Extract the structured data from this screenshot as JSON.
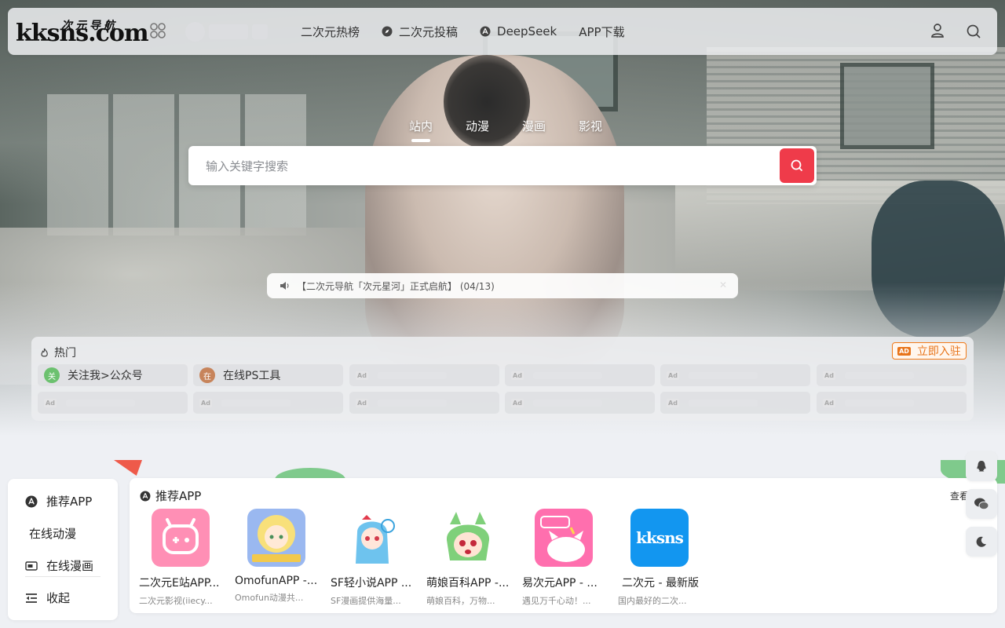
{
  "brand": {
    "logo_main": "kksns.com",
    "logo_sub": "次元导航"
  },
  "nav": {
    "links": [
      {
        "label": "二次元热榜",
        "icon": "none"
      },
      {
        "label": "二次元投稿",
        "icon": "compass-icon"
      },
      {
        "label": "DeepSeek",
        "icon": "app-store-icon"
      },
      {
        "label": "APP下载",
        "icon": "none"
      }
    ]
  },
  "search": {
    "tabs": [
      "站内",
      "动漫",
      "漫画",
      "影视"
    ],
    "active_tab": "站内",
    "placeholder": "输入关键字搜索",
    "button_color": "#ef3b4a"
  },
  "notice": {
    "text": "【二次元导航「次元星河」正式启航】 (04/13)"
  },
  "hot": {
    "title": "热门",
    "join_label": "立即入驻",
    "join_badge": "AD",
    "cells": [
      {
        "label": "关注我>公众号",
        "avatar_text": "关",
        "avatar_color": "#6cc16f"
      },
      {
        "label": "在线PS工具",
        "avatar_text": "在",
        "avatar_color": "#c7845b"
      }
    ],
    "ad_tag": "Ad"
  },
  "sidebar": {
    "items": [
      {
        "label": "推荐APP",
        "icon": "app-store-icon"
      },
      {
        "label": "在线动漫",
        "icon": "none"
      },
      {
        "label": "在线漫画",
        "icon": "comic-icon"
      },
      {
        "label": "收起",
        "icon": "collapse-icon"
      }
    ]
  },
  "panel": {
    "title": "推荐APP",
    "more": "查看更多",
    "apps": [
      {
        "name": "二次元E站APP...",
        "desc": "二次元影视(iiecy...",
        "icon_color": "#ff8fb5"
      },
      {
        "name": "OmofunAPP -...",
        "desc": "Omofun动漫共...",
        "icon_color": "#9ab8f0"
      },
      {
        "name": "SF轻小说APP ...",
        "desc": "SF漫画提供海量...",
        "icon_color": "#ffffff"
      },
      {
        "name": "萌娘百科APP -...",
        "desc": "萌娘百科，万物...",
        "icon_color": "#ffffff"
      },
      {
        "name": "易次元APP - ...",
        "desc": "遇见万千心动！...",
        "icon_color": "#ff6fae"
      },
      {
        "name": "二次元 - 最新版",
        "desc": "国内最好的二次...",
        "icon_color": "#1296f0",
        "icon_text": "kksns"
      }
    ]
  },
  "float": {
    "buttons": [
      "qq-icon",
      "wechat-icon",
      "dark-mode-icon"
    ]
  }
}
